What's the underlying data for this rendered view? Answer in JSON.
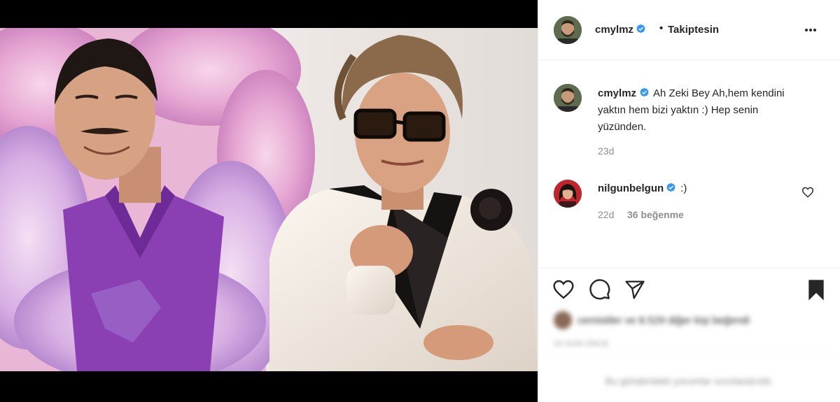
{
  "post": {
    "author": {
      "username": "cmylmz",
      "verified": true,
      "follow_separator": "•",
      "follow_status": "Takiptesin",
      "avatar_icon": "profile-photo-man-beard"
    },
    "more_icon": "more-horizontal-icon",
    "caption": {
      "username": "cmylmz",
      "text": "Ah Zeki Bey Ah,hem kendini yaktın hem bizi yaktın :) Hep senin yüzünden.",
      "time": "23d"
    },
    "comments": [
      {
        "username": "nilgunbelgun",
        "verified": true,
        "text": ":)",
        "time": "22d",
        "likes": "36 beğenme",
        "avatar_icon": "profile-photo-woman-dark-hair"
      }
    ],
    "actions": {
      "like_icon": "heart-outline-icon",
      "comment_icon": "comment-bubble-icon",
      "share_icon": "paper-plane-icon",
      "save_icon": "bookmark-filled-icon"
    },
    "likes_summary": "cemistiler ve 8.529 diğer kişi beğendi",
    "posted_ago": "23 GÜN ÖNCE",
    "comments_limited": "Bu gönderideki yorumlar sınırlandırıldı."
  },
  "colors": {
    "text": "#262626",
    "secondary": "#8e8e8e",
    "divider": "#efefef",
    "verified_blue": "#3897f0",
    "media_background": "#000000"
  }
}
